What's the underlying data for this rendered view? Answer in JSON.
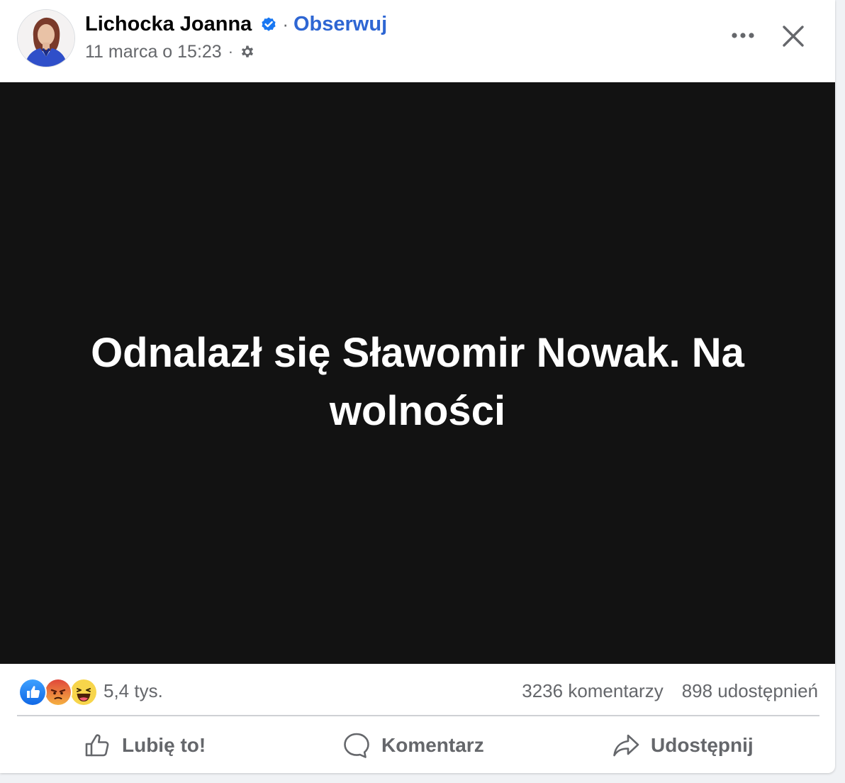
{
  "post": {
    "author": {
      "name": "Lichocka Joanna",
      "verified": true,
      "follow_label": "Obserwuj",
      "separator": "·"
    },
    "meta": {
      "timestamp": "11 marca o 15:23",
      "separator": "·",
      "privacy_icon": "gear-icon"
    },
    "header_actions": {
      "more_icon": "more-horizontal-icon",
      "close_icon": "close-icon"
    },
    "media": {
      "text": "Odnalazł się Sławomir Nowak. Na wolności"
    },
    "reactions": {
      "icons": [
        "like-reaction-icon",
        "angry-reaction-icon",
        "haha-reaction-icon"
      ],
      "count": "5,4 tys."
    },
    "stats": {
      "comments": "3236 komentarzy",
      "shares": "898 udostępnień"
    },
    "actions": {
      "like_label": "Lubię to!",
      "comment_label": "Komentarz",
      "share_label": "Udostępnij"
    }
  },
  "colors": {
    "follow_blue": "#2e66d3",
    "verified_blue": "#1877f2",
    "secondary_text": "#65676b",
    "media_background": "#121212",
    "like_blue": "#1877f2",
    "angry_orange": "#f0533c",
    "haha_yellow": "#f7d54b"
  }
}
